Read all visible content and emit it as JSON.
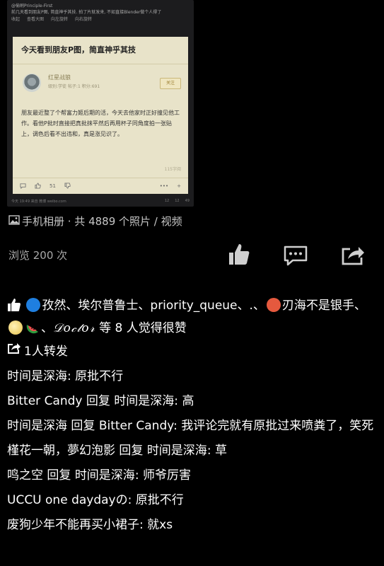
{
  "screenshot": {
    "poster_line": "@偷刷Principle-First",
    "caption_line": "前几天看到朋友P图, 简直神乎其技. 拍了片就发来, 不如直接Blender做个人得了",
    "actions": [
      "收起",
      "查看大图",
      "向左旋转",
      "向右旋转"
    ],
    "card": {
      "title": "今天看到朋友P图，简直神乎其技",
      "author_name": "红星战狼",
      "author_meta": "级别:学徒 帖子:1 积分:691",
      "follow_label": "关注",
      "body": "朋友最近整了个帮富力姬后期的活，今天去他家时正好撞见他工作。看他P批时直接把真批抹平然后再用杯子同角度拍一张贴上，调色后看不出违和，真是涨见识了。",
      "word_count": "115字阅",
      "like_count": "51"
    },
    "status_left": "今天 19:49 来自 微博 weibo.com",
    "status_right": [
      "12",
      "12",
      "49"
    ]
  },
  "album": {
    "label": "手机相册 · 共 4889 个照片 / 视频",
    "icon": "photo-icon"
  },
  "views": "浏览 200 次",
  "actions": {
    "like_icon": "thumbs-up-icon",
    "comment_icon": "comment-bubble-icon",
    "share_icon": "share-icon"
  },
  "likes": {
    "names_part1": "孜然、埃尔普鲁士、priority_queue、.、",
    "names_part2": "刃海不是银手、",
    "names_part3": "、",
    "doctor_name": "𝒟𝑜𝒸𝓉𝑜𝓇",
    "suffix": " 等 8 人觉得很赞"
  },
  "reposts": "1人转发",
  "comments": [
    {
      "author": "时间是深海",
      "reply_to": "",
      "text": "原批不行"
    },
    {
      "author": "Bitter Candy",
      "reply_to": "时间是深海",
      "text": "高"
    },
    {
      "author": "时间是深海",
      "reply_to": "Bitter Candy",
      "text": "我评论完就有原批过来喷粪了，笑死"
    },
    {
      "author": "槿花一朝，夢幻泡影",
      "reply_to": "时间是深海",
      "text": "草"
    },
    {
      "author": "鸣之空",
      "reply_to": "时间是深海",
      "text": "师爷厉害"
    },
    {
      "author": "UCCU one daydayの",
      "reply_to": "",
      "text": "原批不行"
    },
    {
      "author": "废狗少年不能再买小裙子",
      "reply_to": "",
      "text": "就xs"
    }
  ],
  "reply_word": "回复",
  "colors": {
    "background": "#000000",
    "text": "#ffffff",
    "muted": "#a9a9a9",
    "card": "#e8e3c9"
  }
}
